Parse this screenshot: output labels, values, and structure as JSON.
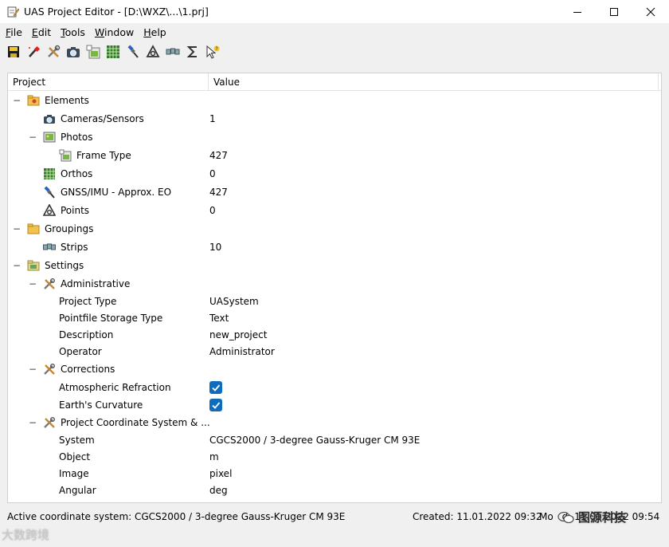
{
  "window": {
    "title": "UAS Project Editor - [D:\\WXZ\\...\\1.prj]",
    "app_icon": "notepad-pencil-icon"
  },
  "menu": [
    {
      "label": "File",
      "accel": "F",
      "rest": "ile"
    },
    {
      "label": "Edit",
      "accel": "E",
      "rest": "dit"
    },
    {
      "label": "Tools",
      "accel": "T",
      "rest": "ools"
    },
    {
      "label": "Window",
      "accel": "W",
      "rest": "indow"
    },
    {
      "label": "Help",
      "accel": "H",
      "rest": "elp"
    }
  ],
  "toolbar": [
    "save-icon",
    "magic-wand-icon",
    "tools-icon",
    "camera-icon",
    "frame-photo-icon",
    "ortho-icon",
    "gnss-satellite-icon",
    "points-icon",
    "strips-icon",
    "sigma-icon",
    "pointer-help-icon"
  ],
  "tree": {
    "header": {
      "project": "Project",
      "value": "Value"
    },
    "rows": [
      {
        "label": "Elements",
        "value": "",
        "icon": "elements-folder-icon",
        "toggle": "−"
      },
      {
        "label": "Cameras/Sensors",
        "value": "1",
        "icon": "camera-icon",
        "toggle": ""
      },
      {
        "label": "Photos",
        "value": "",
        "icon": "photo-icon",
        "toggle": "−"
      },
      {
        "label": "Frame Type",
        "value": "427",
        "icon": "frame-photo-icon",
        "toggle": ""
      },
      {
        "label": "Orthos",
        "value": "0",
        "icon": "ortho-icon",
        "toggle": ""
      },
      {
        "label": "GNSS/IMU - Approx. EO",
        "value": "427",
        "icon": "gnss-satellite-icon",
        "toggle": ""
      },
      {
        "label": "Points",
        "value": "0",
        "icon": "points-icon",
        "toggle": ""
      },
      {
        "label": "Groupings",
        "value": "",
        "icon": "folder-icon",
        "toggle": "−"
      },
      {
        "label": "Strips",
        "value": "10",
        "icon": "strips-icon",
        "toggle": ""
      },
      {
        "label": "Settings",
        "value": "",
        "icon": "settings-folder-icon",
        "toggle": "−"
      },
      {
        "label": "Administrative",
        "value": "",
        "icon": "tools-icon",
        "toggle": "−"
      },
      {
        "label": "Project Type",
        "value": "UASystem",
        "icon": "",
        "toggle": ""
      },
      {
        "label": "Pointfile Storage Type",
        "value": "Text",
        "icon": "",
        "toggle": ""
      },
      {
        "label": "Description",
        "value": "new_project",
        "icon": "",
        "toggle": ""
      },
      {
        "label": "Operator",
        "value": "Administrator",
        "icon": "",
        "toggle": ""
      },
      {
        "label": "Corrections",
        "value": "",
        "icon": "tools-icon",
        "toggle": "−"
      },
      {
        "label": "Atmospheric Refraction",
        "value": "",
        "icon": "",
        "toggle": "",
        "checked": true
      },
      {
        "label": "Earth's Curvature",
        "value": "",
        "icon": "",
        "toggle": "",
        "checked": true
      },
      {
        "label": "Project Coordinate System & ...",
        "value": "",
        "icon": "tools-icon",
        "toggle": "−"
      },
      {
        "label": "System",
        "value": "CGCS2000 / 3-degree Gauss-Kruger CM 93E",
        "icon": "",
        "toggle": ""
      },
      {
        "label": "Object",
        "value": "m",
        "icon": "",
        "toggle": ""
      },
      {
        "label": "Image",
        "value": "pixel",
        "icon": "",
        "toggle": ""
      },
      {
        "label": "Angular",
        "value": "deg",
        "icon": "",
        "toggle": ""
      }
    ]
  },
  "status": {
    "active_cs": "Active coordinate system: CGCS2000 / 3-degree Gauss-Kruger CM 93E",
    "created": "Created: 11.01.2022 09:32",
    "modified": "Mo",
    "modified_tail": "d: 11.01.2022 09:54"
  },
  "watermarks": {
    "bottom_left": "大数跨境",
    "bottom_right": "图源科技"
  },
  "colors": {
    "checkbox": "#0f6cbd",
    "tree_bg": "#ffffff",
    "window_bg": "#f0f0f0"
  }
}
